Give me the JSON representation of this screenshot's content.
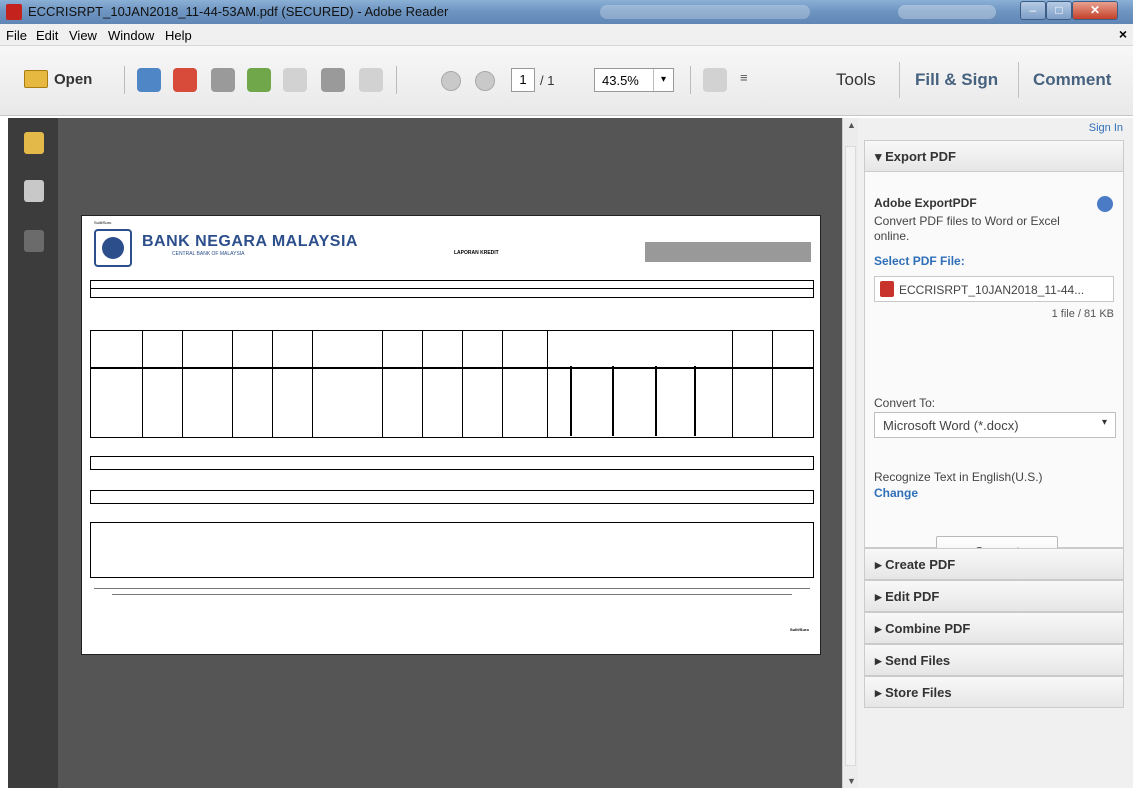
{
  "window": {
    "title": "ECCRISRPT_10JAN2018_11-44-53AM.pdf (SECURED) - Adobe Reader",
    "minimize": "–",
    "maximize": "□",
    "close": "✕"
  },
  "menu": {
    "items": [
      "File",
      "Edit",
      "View",
      "Window",
      "Help"
    ],
    "close_doc": "×"
  },
  "toolbar": {
    "open_label": "Open",
    "page_current": "1",
    "page_total": "/ 1",
    "zoom": "43.5%",
    "zoom_dropdown": "▾",
    "more": "≡",
    "tools": "Tools",
    "fill_sign": "Fill & Sign",
    "comment": "Comment"
  },
  "document": {
    "bank_name": "BANK NEGARA MALAYSIA",
    "bank_sub": "CENTRAL BANK OF MALAYSIA",
    "report_title": "LAPORAN KREDIT",
    "page_tag": "Sulit/Suro",
    "footer_tag": "Sulit/Suro"
  },
  "right_panel": {
    "sign_in": "Sign In",
    "export_header": "▾  Export PDF",
    "export_title": "Adobe ExportPDF",
    "export_desc": "Convert PDF files to Word or Excel online.",
    "select_label": "Select PDF File:",
    "file_name": "ECCRISRPT_10JAN2018_11-44...",
    "file_meta": "1 file / 81 KB",
    "convert_to_label": "Convert To:",
    "convert_to_value": "Microsoft Word (*.docx)",
    "convert_to_dropdown": "▾",
    "recognize_label": "Recognize Text in English(U.S.)",
    "change_link": "Change",
    "convert_button": "Convert",
    "sections": [
      {
        "label": "▸  Create PDF"
      },
      {
        "label": "▸  Edit PDF"
      },
      {
        "label": "▸  Combine PDF"
      },
      {
        "label": "▸  Send Files"
      },
      {
        "label": "▸  Store Files"
      }
    ]
  },
  "colors": {
    "title_bar": "#6f96c2",
    "doc_background": "#555555",
    "left_nav": "#3c3c3c",
    "link_blue": "#2f6fb8",
    "bank_blue": "#2c4f8c"
  }
}
